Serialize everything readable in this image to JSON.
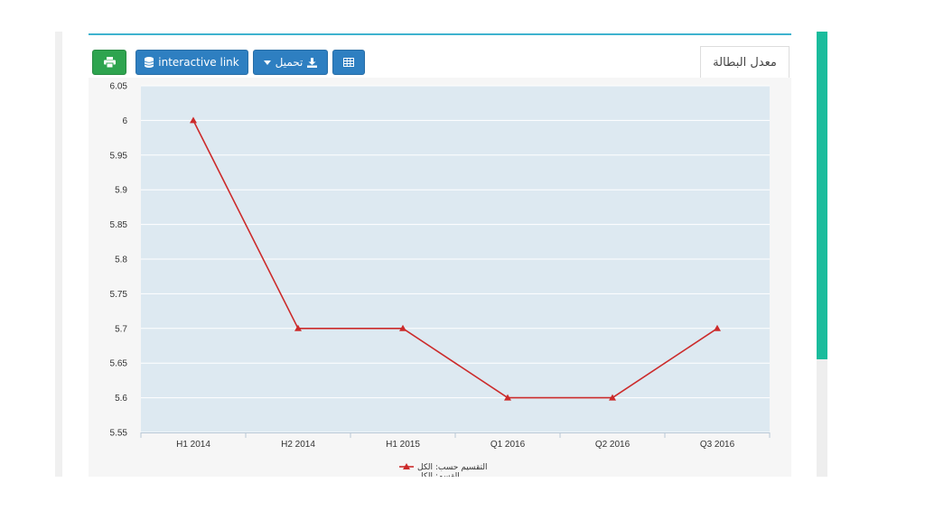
{
  "toolbar": {
    "interactive_link_label": "interactive link",
    "download_label": "تحميل",
    "print_icon": "printer-icon",
    "database_icon": "database-icon",
    "download_icon": "download-icon",
    "dropdown_icon": "caret-down-icon",
    "table_icon": "table-icon"
  },
  "tab": {
    "label": "معدل البطالة"
  },
  "colors": {
    "accent_teal": "#1abc9c",
    "button_blue": "#2e7fc1",
    "button_green": "#2ea44f",
    "series_red": "#cc2b2b",
    "plot_bg": "#dde9f1"
  },
  "chart_data": {
    "type": "line",
    "categories": [
      "H1 2014",
      "H2 2014",
      "H1 2015",
      "Q1 2016",
      "Q2 2016",
      "Q3 2016"
    ],
    "series": [
      {
        "name": "التقسيم حسب: الكل",
        "values": [
          6,
          5.7,
          5.7,
          5.6,
          5.6,
          5.7
        ],
        "marker": "triangle"
      }
    ],
    "legend_second_line": "القسم: الكل",
    "ylim": [
      5.55,
      6.05
    ],
    "yticks": [
      "6.05",
      "6",
      "5.95",
      "5.9",
      "5.85",
      "5.8",
      "5.75",
      "5.7",
      "5.65",
      "5.6",
      "5.55"
    ],
    "grid": true,
    "legend_position": "bottom-center"
  }
}
